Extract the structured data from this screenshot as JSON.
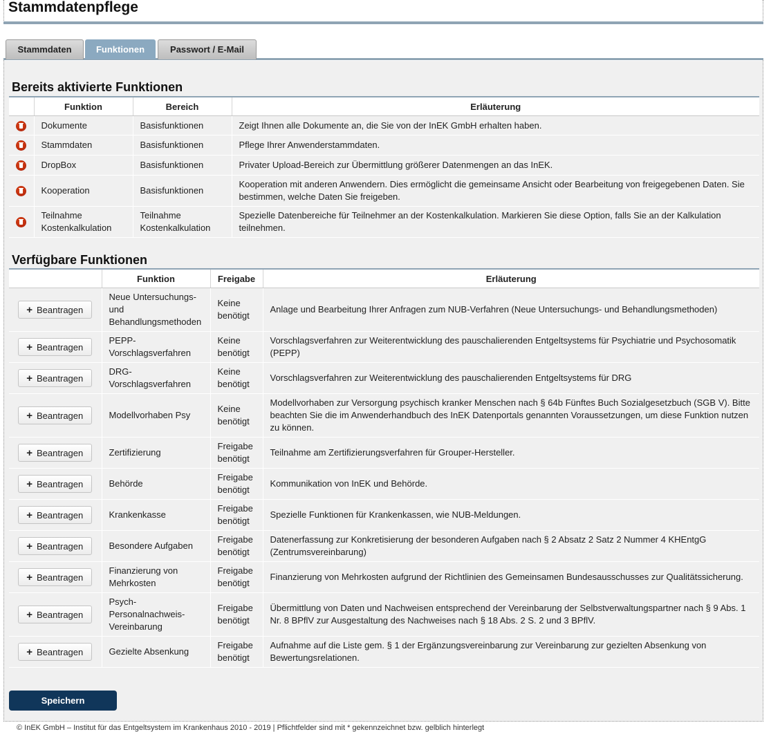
{
  "page_title": "Stammdatenpflege",
  "tabs": [
    {
      "label": "Stammdaten",
      "active": false
    },
    {
      "label": "Funktionen",
      "active": true
    },
    {
      "label": "Passwort / E-Mail",
      "active": false
    }
  ],
  "active_section": {
    "title": "Bereits aktivierte Funktionen",
    "columns": [
      "Funktion",
      "Bereich",
      "Erläuterung"
    ],
    "rows": [
      {
        "funktion": "Dokumente",
        "bereich": "Basisfunktionen",
        "text": "Zeigt Ihnen alle Dokumente an, die Sie von der InEK GmbH erhalten haben."
      },
      {
        "funktion": "Stammdaten",
        "bereich": "Basisfunktionen",
        "text": "Pflege Ihrer Anwenderstammdaten."
      },
      {
        "funktion": "DropBox",
        "bereich": "Basisfunktionen",
        "text": "Privater Upload-Bereich zur Übermittlung größerer Datenmengen an das InEK."
      },
      {
        "funktion": "Kooperation",
        "bereich": "Basisfunktionen",
        "text": "Kooperation mit anderen Anwendern. Dies ermöglicht die gemeinsame Ansicht oder Bearbeitung von freigegebenen Daten. Sie bestimmen, welche Daten Sie freigeben."
      },
      {
        "funktion": "Teilnahme Kostenkalkulation",
        "bereich": "Teilnahme Kostenkalkulation",
        "text": "Spezielle Datenbereiche für Teilnehmer an der Kostenkalkulation. Markieren Sie diese Option, falls Sie an der Kalkulation teilnehmen."
      }
    ]
  },
  "available_section": {
    "title": "Verfügbare Funktionen",
    "columns": [
      "",
      "Funktion",
      "Freigabe",
      "Erläuterung"
    ],
    "button_label": "Beantragen",
    "rows": [
      {
        "funktion": "Neue Untersuchungs- und Behandlungsmethoden",
        "freigabe": "Keine benötigt",
        "text": "Anlage und Bearbeitung Ihrer Anfragen zum NUB-Verfahren (Neue Untersuchungs- und Behandlungsmethoden)"
      },
      {
        "funktion": "PEPP-Vorschlagsverfahren",
        "freigabe": "Keine benötigt",
        "text": "Vorschlagsverfahren zur Weiterentwicklung des pauschalierenden Entgeltsystems für Psychiatrie und Psychosomatik (PEPP)"
      },
      {
        "funktion": "DRG-Vorschlagsverfahren",
        "freigabe": "Keine benötigt",
        "text": "Vorschlagsverfahren zur Weiterentwicklung des pauschalierenden Entgeltsystems für DRG"
      },
      {
        "funktion": "Modellvorhaben Psy",
        "freigabe": "Keine benötigt",
        "text": "Modellvorhaben zur Versorgung psychisch kranker Menschen nach § 64b Fünftes Buch Sozialgesetzbuch (SGB V). Bitte beachten Sie die im Anwenderhandbuch des InEK Datenportals genannten Voraussetzungen, um diese Funktion nutzen zu können."
      },
      {
        "funktion": "Zertifizierung",
        "freigabe": "Freigabe benötigt",
        "text": "Teilnahme am Zertifizierungsverfahren für Grouper-Hersteller."
      },
      {
        "funktion": "Behörde",
        "freigabe": "Freigabe benötigt",
        "text": "Kommunikation von InEK und Behörde."
      },
      {
        "funktion": "Krankenkasse",
        "freigabe": "Freigabe benötigt",
        "text": "Spezielle Funktionen für Krankenkassen, wie NUB-Meldungen."
      },
      {
        "funktion": "Besondere Aufgaben",
        "freigabe": "Freigabe benötigt",
        "text": "Datenerfassung zur Konkretisierung der besonderen Aufgaben nach § 2 Absatz 2 Satz 2 Nummer 4 KHEntgG (Zentrumsvereinbarung)"
      },
      {
        "funktion": "Finanzierung von Mehrkosten",
        "freigabe": "Freigabe benötigt",
        "text": "Finanzierung von Mehrkosten aufgrund der Richtlinien des Gemeinsamen Bundesausschusses zur Qualitätssicherung."
      },
      {
        "funktion": "Psych-Personalnachweis-Vereinbarung",
        "freigabe": "Freigabe benötigt",
        "text": "Übermittlung von Daten und Nachweisen entsprechend der Vereinbarung der Selbstverwaltungspartner nach § 9 Abs. 1 Nr. 8 BPflV zur Ausgestaltung des Nachweises nach § 18 Abs. 2 S. 2 und 3 BPflV."
      },
      {
        "funktion": "Gezielte Absenkung",
        "freigabe": "Freigabe benötigt",
        "text": "Aufnahme auf die Liste gem. § 1 der Ergänzungsvereinbarung zur Vereinbarung zur gezielten Absenkung von Bewertungsrelationen."
      }
    ]
  },
  "save_label": "Speichern",
  "footer": "© InEK GmbH – Institut für das Entgeltsystem im Krankenhaus 2010 - 2019 | Pflichtfelder sind mit * gekennzeichnet bzw. gelblich hinterlegt",
  "icons": {
    "delete": "trash-icon",
    "add": "plus-icon"
  },
  "colors": {
    "accent": "#8fa4b4",
    "active_tab": "#8ba9c0",
    "save_button": "#10365a",
    "delete_icon": "#c8340f",
    "content_bg": "#f0f0f0"
  }
}
